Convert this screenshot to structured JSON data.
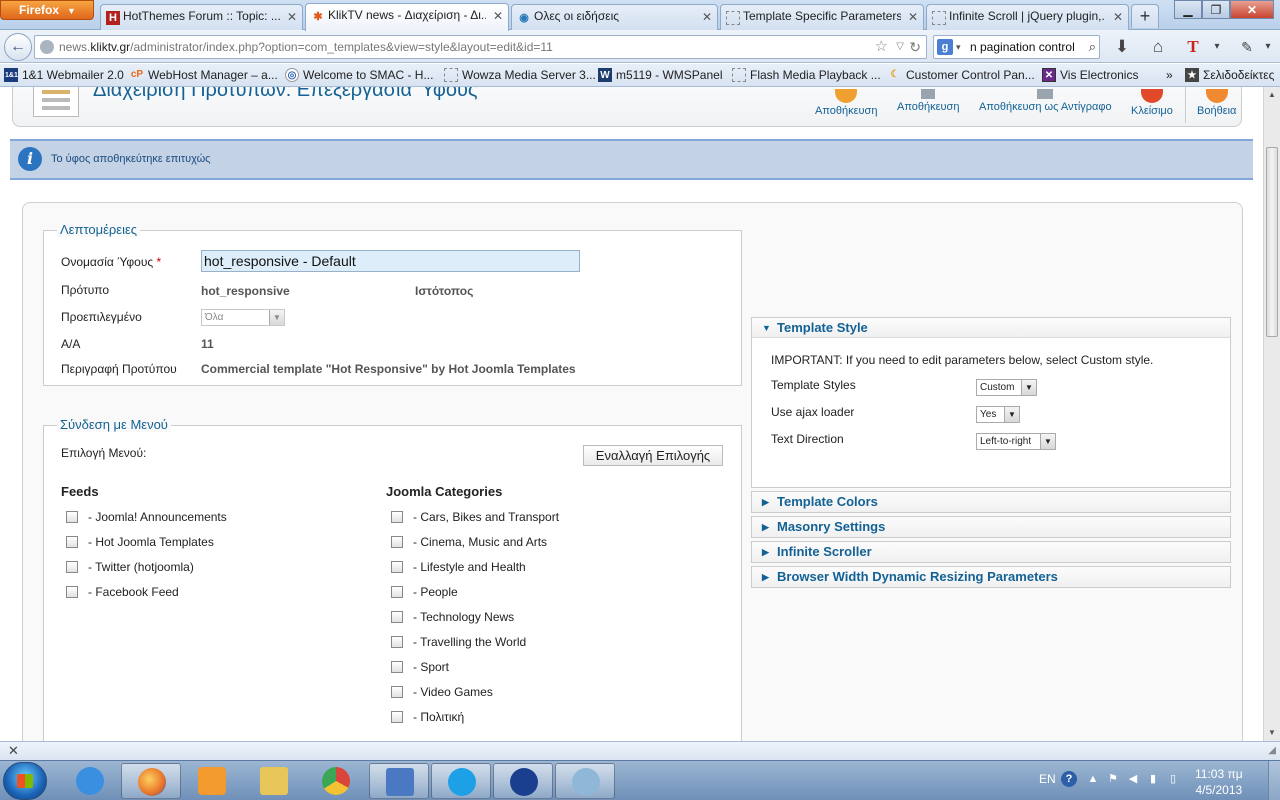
{
  "browser": {
    "firefox_button": "Firefox",
    "tabs": [
      {
        "title": "HotThemes Forum :: Topic: ...",
        "icon": "H"
      },
      {
        "title": "KlikTV news - Διαχείριση - Δι...",
        "icon": "J"
      },
      {
        "title": "Ολες οι ειδήσεις",
        "icon": "◉"
      },
      {
        "title": "Template Specific Parameters",
        "icon": ""
      },
      {
        "title": "Infinite Scroll | jQuery plugin,...",
        "icon": ""
      }
    ],
    "url_prefix": "news.",
    "url_domain": "kliktv.gr",
    "url_rest": "/administrator/index.php?option=com_templates&view=style&layout=edit&id=11",
    "search_text": "n pagination control",
    "bookmarks": [
      {
        "label": "1&1 Webmailer 2.0",
        "icon": "1&1"
      },
      {
        "label": "WebHost Manager – a...",
        "icon": "cP"
      },
      {
        "label": "Welcome to SMAC - H...",
        "icon": "◎"
      },
      {
        "label": "Wowza Media Server 3...",
        "icon": ""
      },
      {
        "label": "m5119 - WMSPanel",
        "icon": "W"
      },
      {
        "label": "Flash Media Playback ...",
        "icon": ""
      },
      {
        "label": "Customer Control Pan...",
        "icon": "☾"
      },
      {
        "label": "Vis Electronics",
        "icon": "✕"
      },
      {
        "label": "Σελιδοδείκτες",
        "icon": "★"
      }
    ],
    "bookmarks_overflow": "»"
  },
  "toolbar": {
    "page_title": "Διαχείριση Προτύπων: Επεξεργασία  Ύφους",
    "buttons": [
      {
        "label": "Αποθήκευση",
        "color": "#f0a030"
      },
      {
        "label": "Αποθήκευση",
        "color": "#9aa4ae"
      },
      {
        "label": "Αποθήκευση ως Αντίγραφο",
        "color": "#9aa4ae"
      },
      {
        "label": "Κλείσιμο",
        "color": "#e04a2a"
      },
      {
        "label": "Βοήθεια",
        "color": "#f08a30"
      }
    ]
  },
  "message": {
    "text": "Το ύφος αποθηκεύτηκε επιτυχώς"
  },
  "details": {
    "legend": "Λεπτομέρειες",
    "style_name_label": "Ονομασία Ύφους",
    "required_mark": "*",
    "style_name_value": "hot_responsive - Default",
    "template_label": "Πρότυπο",
    "template_value": "hot_responsive",
    "site_value": "Ιστότοπος",
    "default_label": "Προεπιλεγμένο",
    "default_value": "Όλα",
    "id_label": "Α/Α",
    "id_value": "11",
    "description_label": "Περιγραφή Προτύπου",
    "description_value": "Commercial template \"Hot Responsive\" by Hot Joomla Templates"
  },
  "menu_assignment": {
    "legend": "Σύνδεση με Μενού",
    "select_label": "Επιλογή Μενού:",
    "toggle_label": "Εναλλαγή Επιλογής",
    "feeds_header": "Feeds",
    "feeds": [
      "- Joomla! Announcements",
      "- Hot Joomla Templates",
      "- Twitter (hotjoomla)",
      "- Facebook Feed"
    ],
    "categories_header": "Joomla Categories",
    "categories": [
      "- Cars, Bikes and Transport",
      "- Cinema, Music and Arts",
      "- Lifestyle and Health",
      "- People",
      "- Technology News",
      "- Travelling the World",
      "- Sport",
      "- Video Games",
      "- Πολιτική"
    ]
  },
  "params": {
    "template_style": {
      "title": "Template Style",
      "important_note": "IMPORTANT: If you need to edit parameters below, select Custom style.",
      "rows": [
        {
          "label": "Template Styles",
          "value": "Custom"
        },
        {
          "label": "Use ajax loader",
          "value": "Yes"
        },
        {
          "label": "Text Direction",
          "value": "Left-to-right"
        }
      ]
    },
    "collapsed_panels": [
      "Template Colors",
      "Masonry Settings",
      "Infinite Scroller",
      "Browser Width Dynamic Resizing Parameters"
    ]
  },
  "taskbar": {
    "language": "EN",
    "time": "11:03 πμ",
    "date": "4/5/2013",
    "apps": [
      {
        "name": "internet-explorer",
        "color": "#3b8fe0"
      },
      {
        "name": "firefox",
        "color": "#e8742a"
      },
      {
        "name": "media-player",
        "color": "#f29a2e"
      },
      {
        "name": "file-explorer",
        "color": "#e8c65a"
      },
      {
        "name": "chrome",
        "color": "#d9453a"
      },
      {
        "name": "remote-desktop",
        "color": "#4a78c2"
      },
      {
        "name": "skype",
        "color": "#1ea0e6"
      },
      {
        "name": "app-slash",
        "color": "#1b3f8f"
      },
      {
        "name": "paint",
        "color": "#8fb7d8"
      }
    ]
  }
}
